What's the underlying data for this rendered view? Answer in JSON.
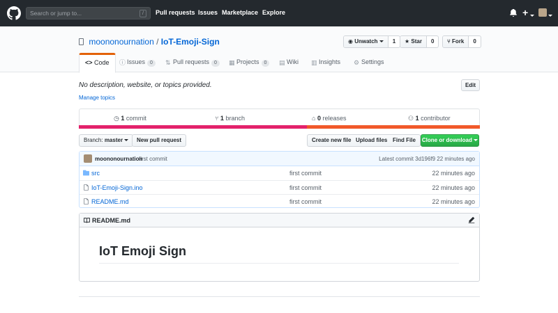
{
  "header": {
    "search_placeholder": "Search or jump to...",
    "search_shortcut": "/",
    "nav": [
      "Pull requests",
      "Issues",
      "Marketplace",
      "Explore"
    ],
    "plus_label": "+"
  },
  "repo": {
    "owner": "moononournation",
    "separator": "/",
    "name": "IoT-Emoji-Sign",
    "watch_label": "Unwatch",
    "watch_count": "1",
    "star_label": "Star",
    "star_count": "0",
    "fork_label": "Fork",
    "fork_count": "0"
  },
  "tabs": [
    {
      "label": "Code",
      "count": null
    },
    {
      "label": "Issues",
      "count": "0"
    },
    {
      "label": "Pull requests",
      "count": "0"
    },
    {
      "label": "Projects",
      "count": "0"
    },
    {
      "label": "Wiki",
      "count": null
    },
    {
      "label": "Insights",
      "count": null
    },
    {
      "label": "Settings",
      "count": null
    }
  ],
  "about": {
    "description": "No description, website, or topics provided.",
    "manage_topics": "Manage topics",
    "edit_label": "Edit"
  },
  "summary": {
    "commits_num": "1",
    "commits_label": "commit",
    "branches_num": "1",
    "branches_label": "branch",
    "releases_num": "0",
    "releases_label": "releases",
    "contributors_num": "1",
    "contributors_label": "contributor"
  },
  "language_colors": [
    "#e3216b",
    "#f1592a"
  ],
  "toolbar": {
    "branch_label": "Branch:",
    "branch_value": "master",
    "new_pr": "New pull request",
    "create_file": "Create new file",
    "upload_files": "Upload files",
    "find_file": "Find File",
    "clone": "Clone or download"
  },
  "latest_commit": {
    "user": "moononournation",
    "message": "first commit",
    "latest_label": "Latest commit 3d196f9 22 minutes ago"
  },
  "files": [
    {
      "name": "src",
      "type": "folder",
      "message": "first commit",
      "age": "22 minutes ago"
    },
    {
      "name": "IoT-Emoji-Sign.ino",
      "type": "file",
      "message": "first commit",
      "age": "22 minutes ago"
    },
    {
      "name": "README.md",
      "type": "file",
      "message": "first commit",
      "age": "22 minutes ago"
    }
  ],
  "readme": {
    "file_label": "README.md",
    "heading": "IoT Emoji Sign"
  },
  "colors": {
    "header_bg": "#24292e",
    "link": "#0366d6",
    "tab_accent": "#e36209",
    "clone_green": "#28a745"
  }
}
